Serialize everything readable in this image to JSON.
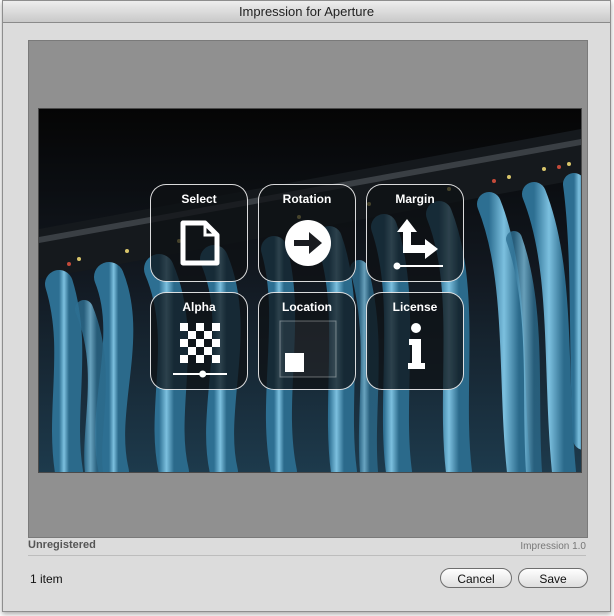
{
  "window": {
    "title": "Impression for Aperture"
  },
  "tiles": [
    {
      "label": "Select",
      "icon": "document-icon"
    },
    {
      "label": "Rotation",
      "icon": "arrow-right-circle-icon"
    },
    {
      "label": "Margin",
      "icon": "corner-arrow-icon",
      "slider_level": 0.0
    },
    {
      "label": "Alpha",
      "icon": "checkerboard-icon",
      "slider_level": 0.55
    },
    {
      "label": "Location",
      "icon": "position-square-icon"
    },
    {
      "label": "License",
      "icon": "info-icon"
    }
  ],
  "status": {
    "left": "Unregistered",
    "right": "Impression 1.0"
  },
  "footer": {
    "item_count": "1 item",
    "cancel_label": "Cancel",
    "save_label": "Save"
  },
  "colors": {
    "window_bg": "#dcdcdc",
    "stage_bg": "#909090",
    "cable_blue": "#5fa6c9"
  }
}
